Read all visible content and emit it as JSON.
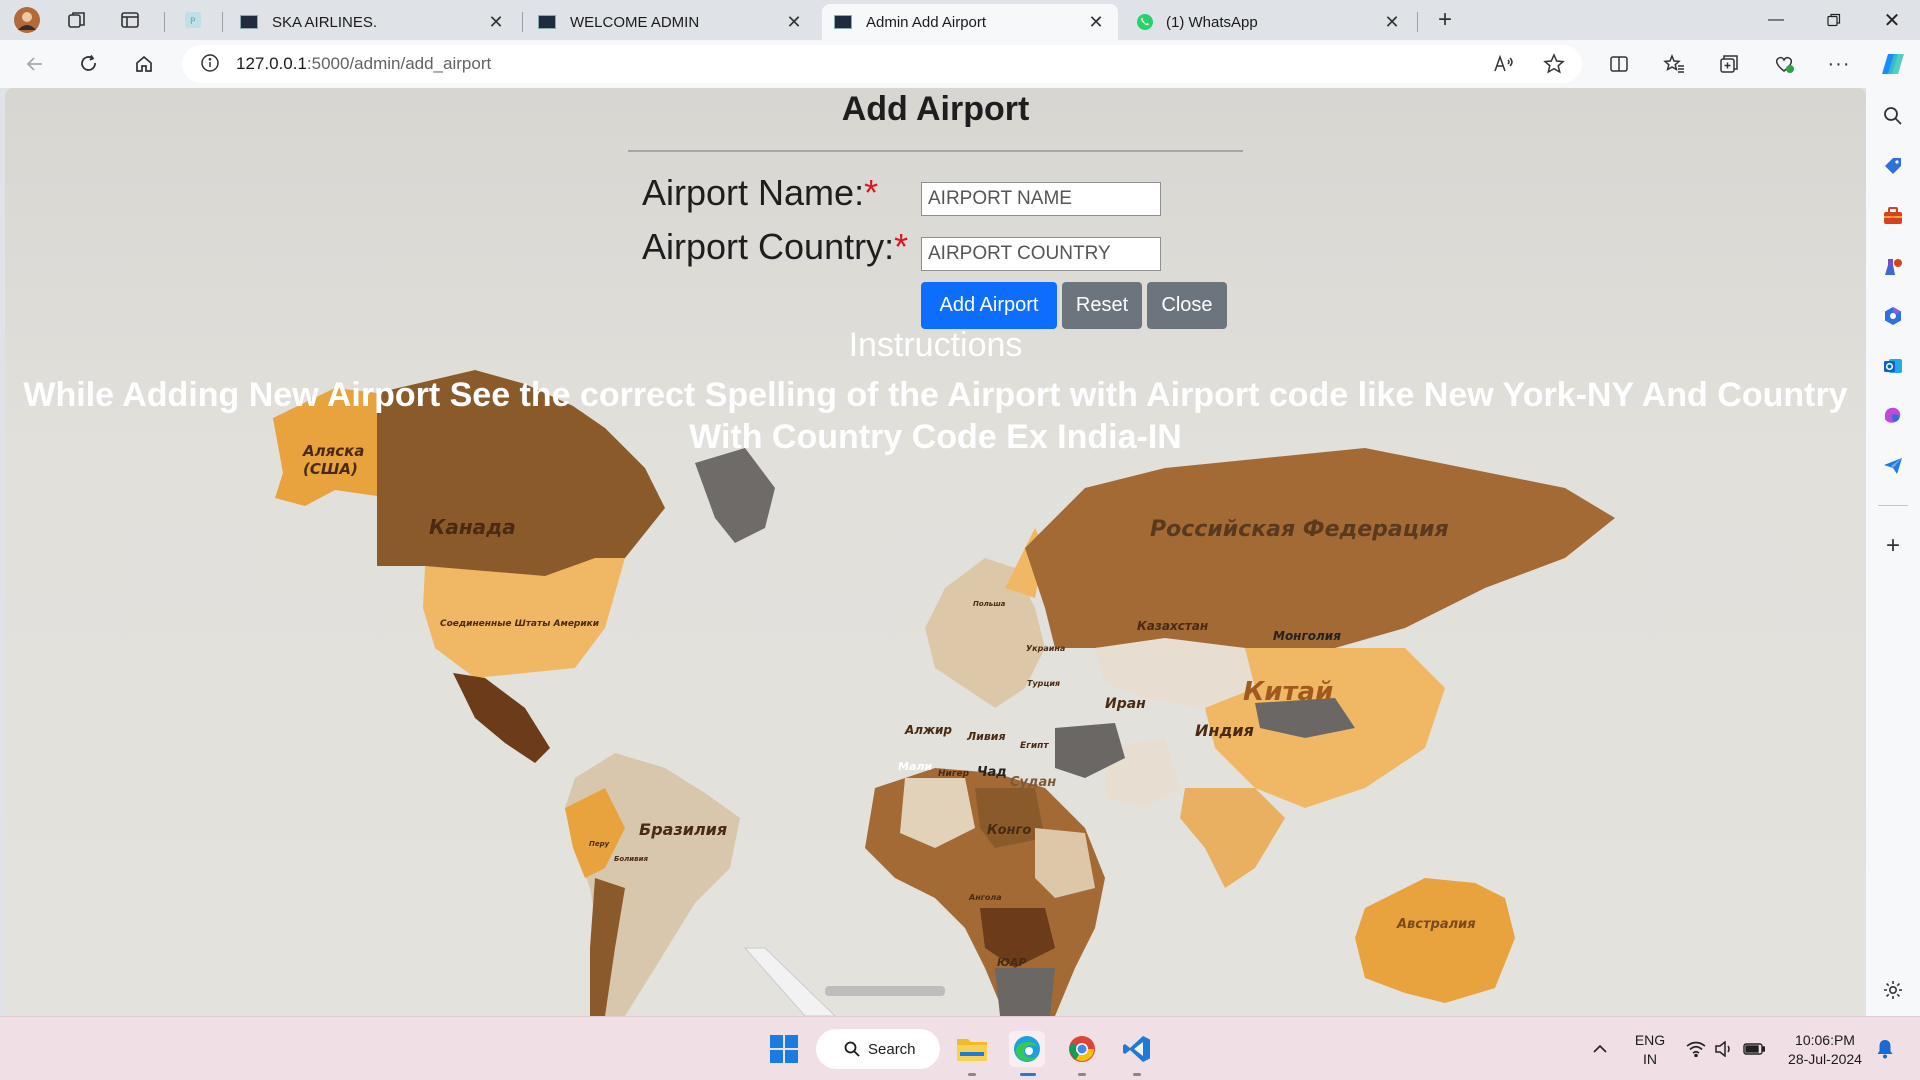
{
  "browser": {
    "tabs": [
      {
        "title": "SKA AIRLINES.",
        "active": false
      },
      {
        "title": "WELCOME ADMIN",
        "active": false
      },
      {
        "title": "Admin Add Airport",
        "active": true
      },
      {
        "title": "(1) WhatsApp",
        "active": false
      }
    ],
    "url_host": "127.0.0.1",
    "url_path": ":5000/admin/add_airport"
  },
  "page": {
    "title": "Add Airport",
    "form": {
      "name_label": "Airport Name:",
      "name_placeholder": "AIRPORT NAME",
      "country_label": "Airport Country:",
      "country_placeholder": "AIRPORT COUNTRY",
      "required_mark": "*"
    },
    "buttons": {
      "add": "Add Airport",
      "reset": "Reset",
      "close": "Close"
    },
    "instructions_title": "Instructions",
    "instructions_text": "While Adding New Airport See the correct Spelling of the Airport with Airport code like New York-NY And Country With Country Code Ex India-IN"
  },
  "background_map_labels": {
    "alaska": "Аляска",
    "alaska_2": "(США)",
    "canada": "Канада",
    "usa": "Соединенные Штаты Америки",
    "russia": "Российская Федерация",
    "kazakhstan": "Казахстан",
    "mongolia": "Монголия",
    "china": "Китай",
    "india": "Индия",
    "iran": "Иран",
    "brazil": "Бразилия",
    "algeria": "Алжир",
    "libya": "Ливия",
    "egypt": "Египт",
    "sudan": "Судан",
    "chad": "Чад",
    "mali": "Мали",
    "niger": "Нигер",
    "congo": "Конго",
    "australia": "Австралия",
    "ukraine": "Украина",
    "turkey": "Турция",
    "poland": "Польша",
    "peru": "Перу",
    "bolivia": "Боливия",
    "angola": "Ангола",
    "sar": "ЮАР"
  },
  "taskbar": {
    "search_label": "Search",
    "lang_1": "ENG",
    "lang_2": "IN",
    "time": "10:06:PM",
    "date": "28-Jul-2024"
  },
  "colors": {
    "primary_button": "#0d6efd",
    "secondary_button": "#6c757d",
    "required": "#e0141e"
  }
}
